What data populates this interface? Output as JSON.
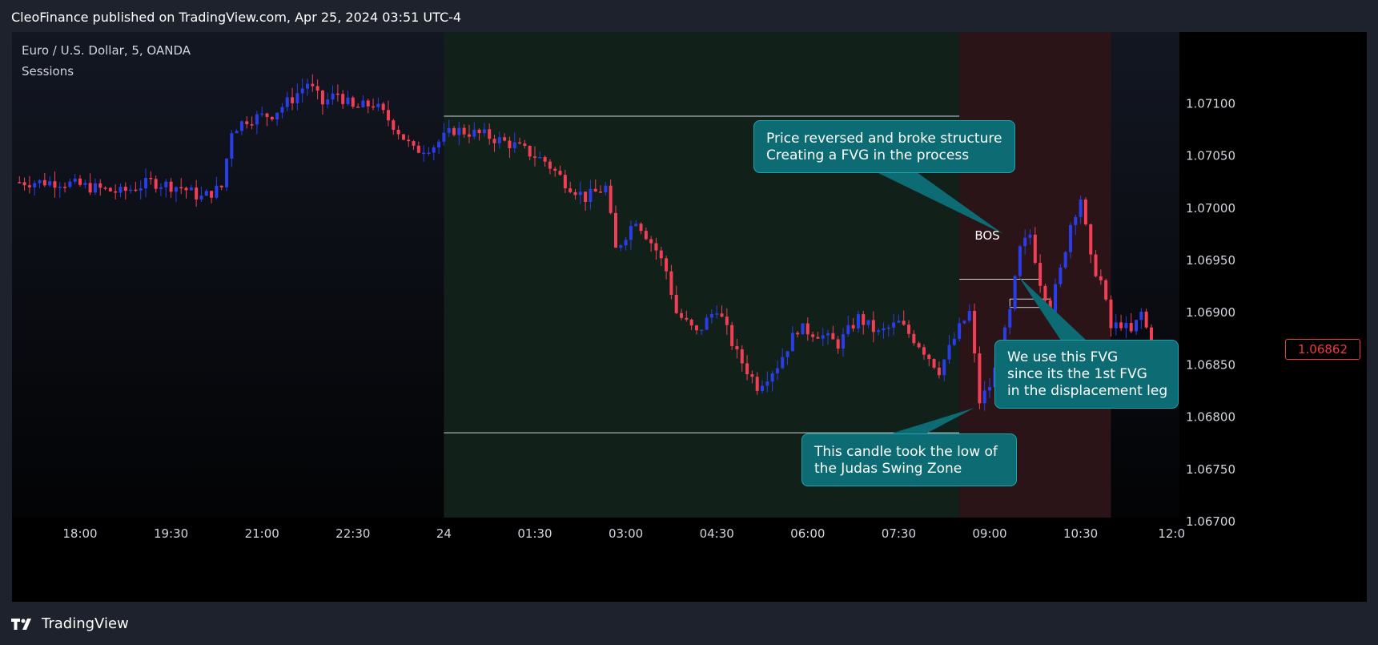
{
  "header": {
    "published_text": "CleoFinance published on TradingView.com, Apr 25, 2024 03:51 UTC-4"
  },
  "legend": {
    "symbol_line": "Euro / U.S. Dollar, 5, OANDA",
    "indicator": "Sessions"
  },
  "annotations": {
    "bos_label": "BOS",
    "callout_structure": [
      "Price reversed and broke structure",
      "Creating a FVG in the process"
    ],
    "callout_fvg": [
      "We use this FVG",
      "since its the 1st FVG",
      "in the displacement leg"
    ],
    "callout_low": [
      "This candle took the low of",
      "the Judas Swing Zone"
    ]
  },
  "footer": {
    "brand": "TradingView"
  },
  "colors": {
    "up": "#2a3ee8",
    "down": "#f23f55",
    "background": "#000000",
    "session_asia": "#112018",
    "session_london": "#2a1418",
    "callout_fill": "#0c6b73",
    "axis_text": "#d1d4dc"
  },
  "chart_data": {
    "type": "candlestick",
    "timeframe_minutes": 5,
    "x_tick_labels": [
      "18:00",
      "19:30",
      "21:00",
      "22:30",
      "24",
      "01:30",
      "03:00",
      "04:30",
      "06:00",
      "07:30",
      "09:00",
      "10:30",
      "12:0"
    ],
    "y_tick_labels": [
      "1.07100",
      "1.07050",
      "1.07000",
      "1.06950",
      "1.06900",
      "1.06850",
      "1.06800",
      "1.06750",
      "1.06700"
    ],
    "ylim": [
      1.0665,
      1.0714
    ],
    "last_price": "1.06862",
    "sessions": [
      {
        "from": "24",
        "to": "08:30",
        "kind": "asia"
      },
      {
        "from": "08:30",
        "to": "11:00",
        "kind": "london"
      }
    ],
    "judas_zone": {
      "high": 1.07088,
      "low": 1.06785
    },
    "bos_level": 1.06932,
    "fvg": {
      "high": 1.06913,
      "low": 1.06905
    },
    "close_path": [
      [
        "17:00",
        1.07025
      ],
      [
        "17:40",
        1.07025
      ],
      [
        "18:10",
        1.0702
      ],
      [
        "18:40",
        1.07015
      ],
      [
        "19:10",
        1.07025
      ],
      [
        "19:40",
        1.0702
      ],
      [
        "20:00",
        1.0701
      ],
      [
        "20:20",
        1.0702
      ],
      [
        "20:30",
        1.07075
      ],
      [
        "20:45",
        1.07085
      ],
      [
        "21:10",
        1.0709
      ],
      [
        "21:30",
        1.07105
      ],
      [
        "21:45",
        1.0712
      ],
      [
        "22:00",
        1.071
      ],
      [
        "22:15",
        1.0711
      ],
      [
        "22:30",
        1.07095
      ],
      [
        "22:50",
        1.071
      ],
      [
        "23:10",
        1.0708
      ],
      [
        "23:30",
        1.07055
      ],
      [
        "23:50",
        1.0706
      ],
      [
        "00:10",
        1.07075
      ],
      [
        "00:40",
        1.0707
      ],
      [
        "01:10",
        1.0706
      ],
      [
        "01:40",
        1.07045
      ],
      [
        "02:00",
        1.07025
      ],
      [
        "02:20",
        1.0701
      ],
      [
        "02:40",
        1.0702
      ],
      [
        "02:50",
        1.0696
      ],
      [
        "03:10",
        1.0699
      ],
      [
        "03:30",
        1.0696
      ],
      [
        "03:40",
        1.0694
      ],
      [
        "03:50",
        1.069
      ],
      [
        "04:10",
        1.0688
      ],
      [
        "04:30",
        1.06905
      ],
      [
        "04:50",
        1.0686
      ],
      [
        "05:10",
        1.0683
      ],
      [
        "05:30",
        1.0685
      ],
      [
        "05:50",
        1.06885
      ],
      [
        "06:10",
        1.0688
      ],
      [
        "06:30",
        1.0687
      ],
      [
        "06:50",
        1.06895
      ],
      [
        "07:10",
        1.0688
      ],
      [
        "07:30",
        1.0689
      ],
      [
        "07:50",
        1.0687
      ],
      [
        "08:10",
        1.06845
      ],
      [
        "08:30",
        1.06885
      ],
      [
        "08:40",
        1.069
      ],
      [
        "08:50",
        1.06815
      ],
      [
        "09:00",
        1.0683
      ],
      [
        "09:10",
        1.0686
      ],
      [
        "09:20",
        1.069
      ],
      [
        "09:30",
        1.0696
      ],
      [
        "09:40",
        1.06975
      ],
      [
        "09:50",
        1.0693
      ],
      [
        "10:00",
        1.06905
      ],
      [
        "10:10",
        1.0694
      ],
      [
        "10:20",
        1.06985
      ],
      [
        "10:30",
        1.0701
      ],
      [
        "10:40",
        1.0695
      ],
      [
        "10:50",
        1.0693
      ],
      [
        "11:00",
        1.06885
      ],
      [
        "11:10",
        1.0689
      ],
      [
        "11:20",
        1.0688
      ],
      [
        "11:30",
        1.069
      ],
      [
        "11:40",
        1.0687
      ],
      [
        "11:50",
        1.06825
      ],
      [
        "12:00",
        1.06862
      ]
    ]
  }
}
